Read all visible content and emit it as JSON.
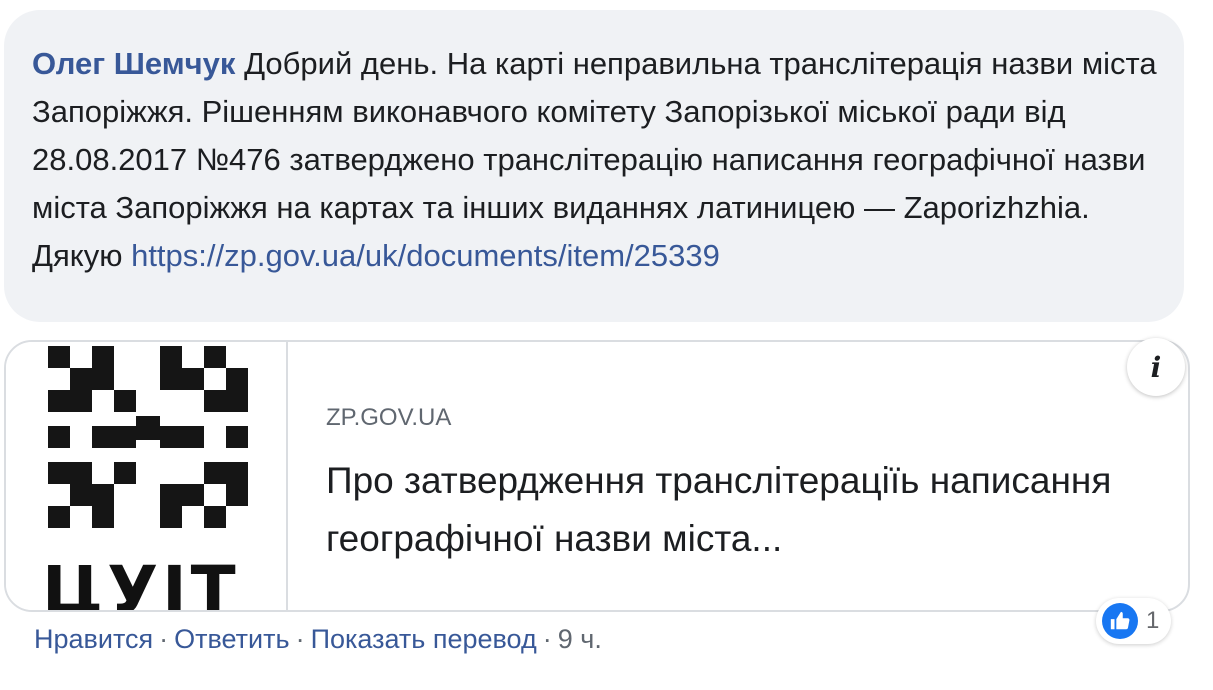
{
  "comment": {
    "author": "Олег Шемчук",
    "text": "Добрий день. На карті неправильна транслітерація назви міста Запоріжжя. Рішенням виконавчого комітету Запорізької міської ради від 28.08.2017 №476 затверджено транслітерацію написання географічної назви міста Запоріжжя на картах та інших виданнях латиницею — Zaporizhzhia. Дякую",
    "link": "https://zp.gov.ua/uk/documents/item/25339"
  },
  "preview": {
    "thumbnail_text": "ЦУІТ",
    "domain": "ZP.GOV.UA",
    "title": "Про затвердження транслітераціїь написання географічної назви міста..."
  },
  "info_button": {
    "label": "i"
  },
  "actions": {
    "like": "Нравится",
    "reply": "Ответить",
    "translate": "Показать перевод",
    "time": "9 ч."
  },
  "reactions": {
    "icon": "thumbs-up-icon",
    "count": "1",
    "color": "#1877f2"
  }
}
